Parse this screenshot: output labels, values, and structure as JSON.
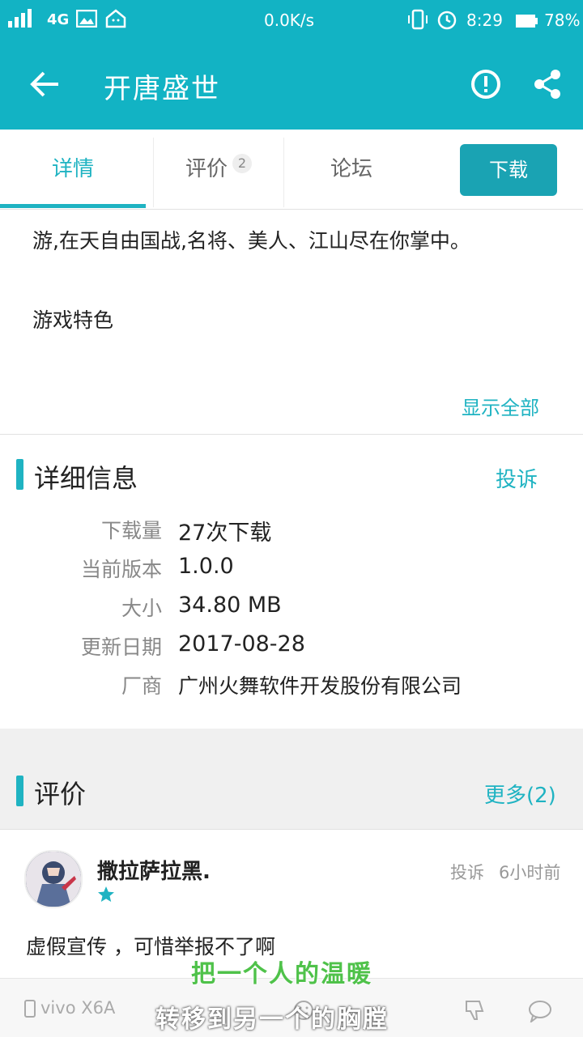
{
  "status_bar": {
    "network": "4G",
    "speed": "0.0K/s",
    "time": "8:29",
    "battery": "78%"
  },
  "app_bar": {
    "title": "开唐盛世",
    "icons": [
      "back-arrow-icon",
      "alert-icon",
      "share-icon"
    ]
  },
  "tabs": [
    {
      "label": "详情",
      "active": true
    },
    {
      "label": "评价",
      "badge": "2"
    },
    {
      "label": "论坛"
    }
  ],
  "download_button": "下载",
  "description": {
    "line1": "游,在天自由国战,名将、美人、江山尽在你掌中。",
    "line2": "游戏特色",
    "show_all": "显示全部"
  },
  "details": {
    "title": "详细信息",
    "report": "投诉",
    "rows": [
      {
        "key": "下载量",
        "value": "27次下载"
      },
      {
        "key": "当前版本",
        "value": "1.0.0"
      },
      {
        "key": "大小",
        "value": "34.80 MB"
      },
      {
        "key": "更新日期",
        "value": "2017-08-28"
      },
      {
        "key": "厂商",
        "value": "广州火舞软件开发股份有限公司"
      }
    ]
  },
  "reviews": {
    "title": "评价",
    "more": "更多(2)",
    "items": [
      {
        "user": "撒拉萨拉黑.",
        "stars": 1,
        "report": "投诉",
        "time": "6小时前",
        "text": "虚假宣传 ，可惜举报不了啊"
      }
    ]
  },
  "watermark": {
    "device": "vivo X6A",
    "caption_line1": "把一个人的温暖",
    "caption_line2": "转移到另一个的胸膛"
  },
  "colors": {
    "accent": "#12b3c4",
    "button": "#1aa3b3",
    "link": "#1fb3c2"
  }
}
